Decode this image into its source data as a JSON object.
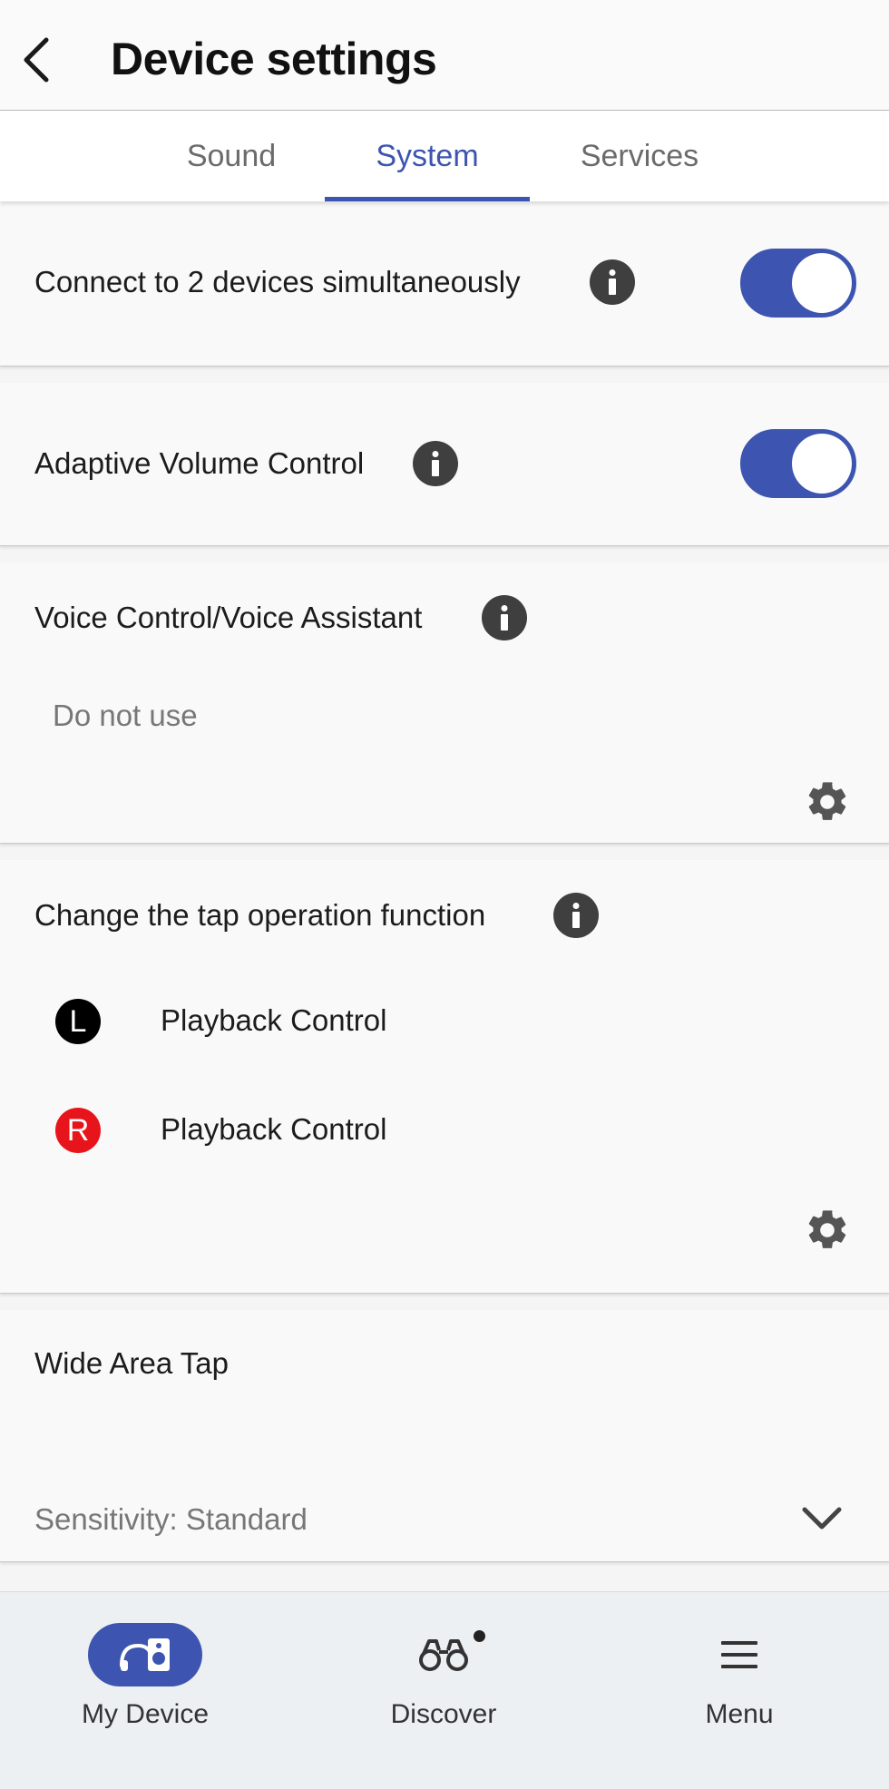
{
  "header": {
    "title": "Device settings"
  },
  "tabs": [
    {
      "label": "Sound",
      "active": false
    },
    {
      "label": "System",
      "active": true
    },
    {
      "label": "Services",
      "active": false
    }
  ],
  "settings": {
    "multipoint": {
      "label": "Connect to 2 devices simultaneously",
      "enabled": true
    },
    "adaptive_volume": {
      "label": "Adaptive Volume Control",
      "enabled": true
    },
    "voice": {
      "label": "Voice Control/Voice Assistant",
      "value": "Do not use"
    },
    "tap": {
      "label": "Change the tap operation function",
      "left_badge": "L",
      "left_value": "Playback Control",
      "right_badge": "R",
      "right_value": "Playback Control"
    },
    "wide_area_tap": {
      "label": "Wide Area Tap",
      "sensitivity": "Sensitivity: Standard"
    }
  },
  "bottom_nav": [
    {
      "label": "My Device",
      "icon": "headphones-speaker-icon",
      "active": true
    },
    {
      "label": "Discover",
      "icon": "binoculars-icon",
      "badge": true
    },
    {
      "label": "Menu",
      "icon": "hamburger-menu-icon"
    }
  ],
  "colors": {
    "accent": "#3d55b0",
    "right_badge": "#e8141c",
    "left_badge": "#000000"
  }
}
